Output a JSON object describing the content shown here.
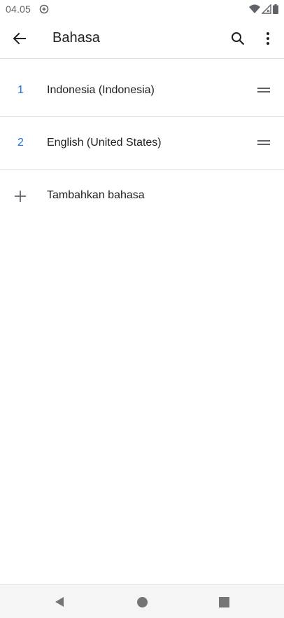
{
  "status_bar": {
    "time": "04.05",
    "icons": [
      "data-saver-icon",
      "wifi-icon",
      "cell-signal-icon",
      "battery-icon"
    ]
  },
  "app_bar": {
    "title": "Bahasa",
    "back_icon": "arrow-back-icon",
    "search_icon": "search-icon",
    "more_icon": "more-vert-icon"
  },
  "languages": [
    {
      "index": "1",
      "name": "Indonesia (Indonesia)"
    },
    {
      "index": "2",
      "name": "English (United States)"
    }
  ],
  "add_language": {
    "label": "Tambahkan bahasa",
    "icon": "plus-icon"
  },
  "nav_bar": {
    "icons": [
      "nav-back-icon",
      "nav-home-icon",
      "nav-recents-icon"
    ]
  },
  "colors": {
    "accent": "#1a73e8",
    "text_primary": "#202124",
    "icon_gray": "#5f6368",
    "divider": "#e0e0e0",
    "nav_background": "#f5f5f5"
  }
}
